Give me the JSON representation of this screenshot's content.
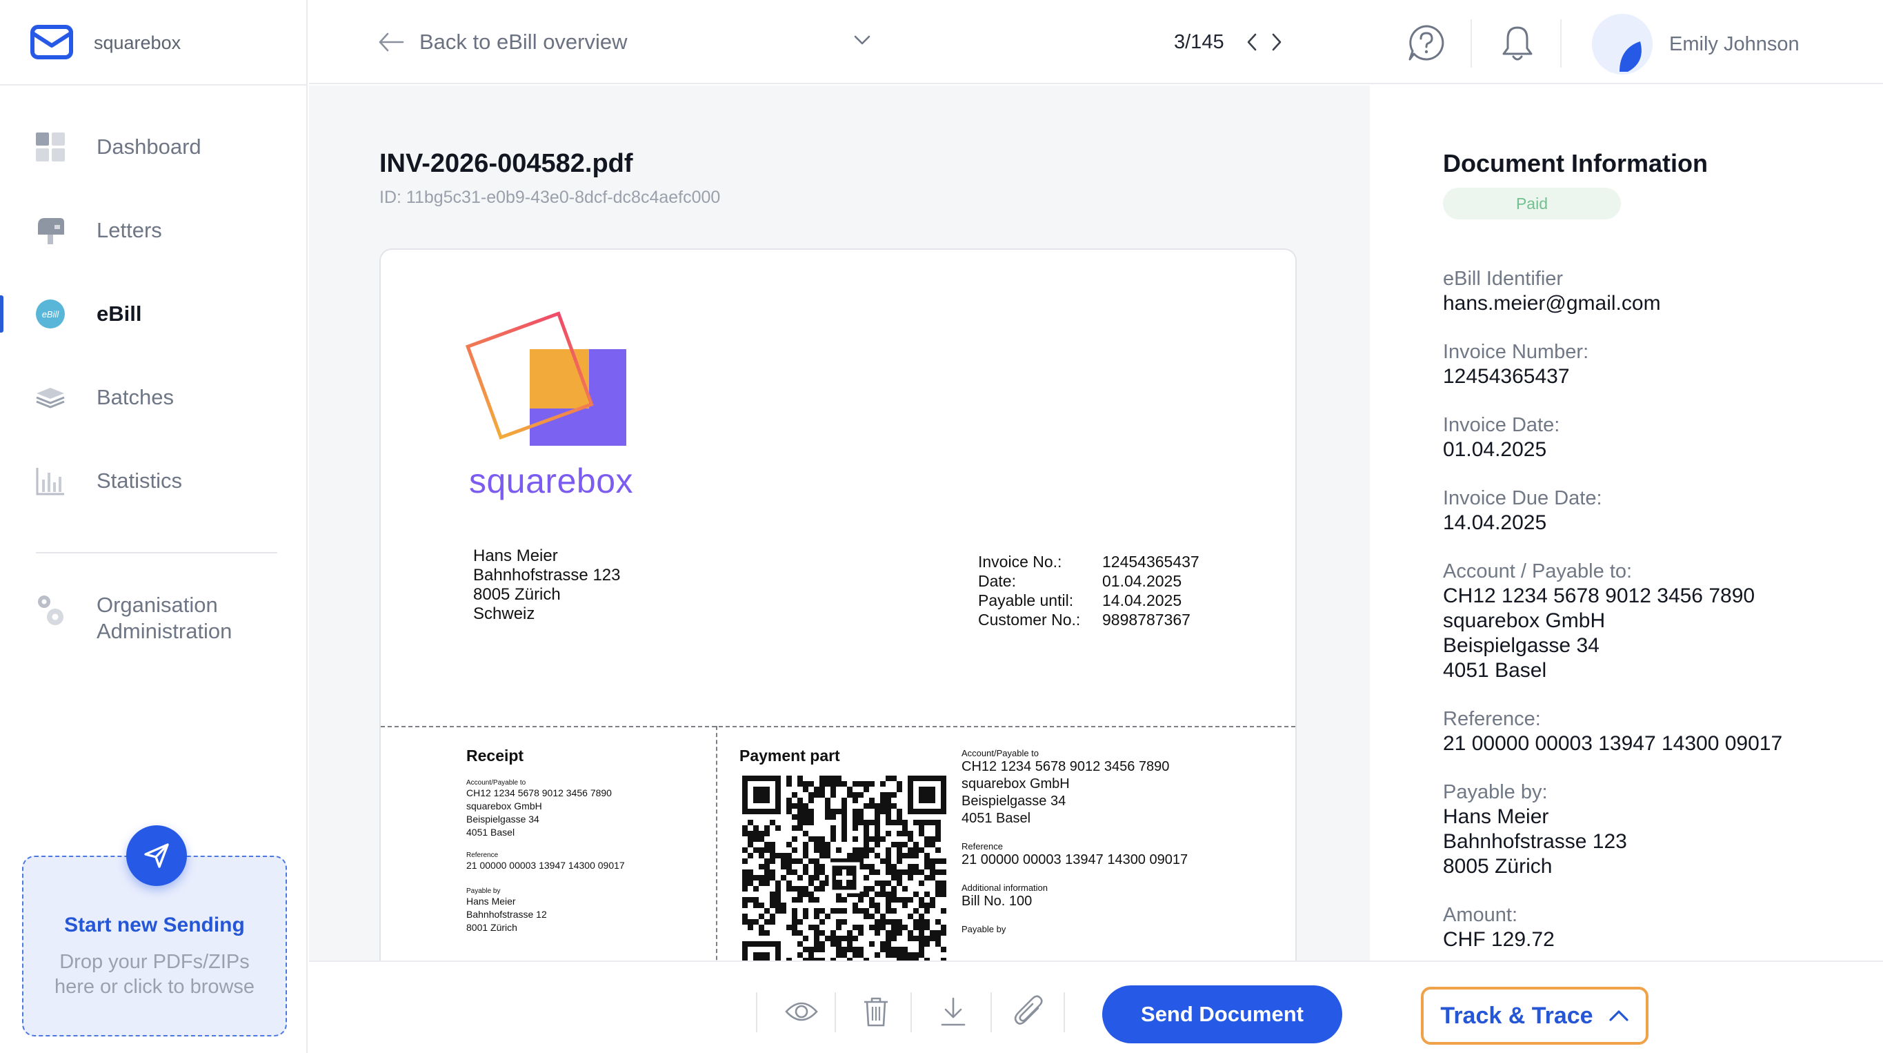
{
  "brand": {
    "name": "squarebox"
  },
  "sidebar": {
    "items": [
      {
        "label": "Dashboard",
        "icon": "dashboard-icon"
      },
      {
        "label": "Letters",
        "icon": "mailbox-icon"
      },
      {
        "label": "eBill",
        "icon": "ebill-icon",
        "badge": "eBill",
        "active": true
      },
      {
        "label": "Batches",
        "icon": "layers-icon"
      },
      {
        "label": "Statistics",
        "icon": "bar-chart-icon"
      }
    ],
    "org": {
      "label": "Organisation Administration",
      "icon": "gears-icon"
    },
    "upload": {
      "title": "Start new Sending",
      "subtitle": "Drop your PDFs/ZIPs here or click to browse",
      "icon": "send-icon"
    }
  },
  "header": {
    "back_label": "Back to eBill overview",
    "pager": "3/145",
    "user": {
      "name": "Emily Johnson"
    }
  },
  "document": {
    "filename": "INV-2026-004582.pdf",
    "id": "ID: 11bg5c31-e0b9-43e0-8dcf-dc8c4aefc000",
    "preview": {
      "logo_text_a": "square",
      "logo_text_b": "box",
      "recipient": [
        "Hans Meier",
        "Bahnhofstrasse 123",
        "8005 Zürich",
        "Schweiz"
      ],
      "meta": [
        {
          "k": "Invoice No.:",
          "v": "12454365437"
        },
        {
          "k": "Date:",
          "v": "01.04.2025"
        },
        {
          "k": "Payable until:",
          "v": "14.04.2025"
        },
        {
          "k": "Customer No.:",
          "v": "9898787367"
        }
      ],
      "receipt": {
        "title": "Receipt",
        "account_label": "Account/Payable to",
        "account": [
          "CH12 1234 5678 9012 3456 7890",
          "squarebox GmbH",
          "Beispielgasse 34",
          "4051 Basel"
        ],
        "reference_label": "Reference",
        "reference": "21 00000 00003 13947 14300 09017",
        "payable_by_label": "Payable by",
        "payable_by": [
          "Hans Meier",
          "Bahnhofstrasse 12",
          "8001 Zürich"
        ]
      },
      "payment": {
        "title": "Payment part",
        "account_label": "Account/Payable to",
        "account": [
          "CH12 1234 5678 9012 3456 7890",
          "squarebox GmbH",
          "Beispielgasse 34",
          "4051 Basel"
        ],
        "reference_label": "Reference",
        "reference": "21 00000 00003 13947 14300 09017",
        "additional_label": "Additional information",
        "additional": "Bill No. 100",
        "payable_by_label": "Payable by"
      }
    }
  },
  "info": {
    "title": "Document Information",
    "status": "Paid",
    "fields": [
      {
        "label": "eBill Identifier",
        "value": [
          "hans.meier@gmail.com"
        ]
      },
      {
        "label": "Invoice Number:",
        "value": [
          "12454365437"
        ]
      },
      {
        "label": "Invoice Date:",
        "value": [
          "01.04.2025"
        ]
      },
      {
        "label": "Invoice Due Date:",
        "value": [
          "14.04.2025"
        ]
      },
      {
        "label": "Account / Payable to:",
        "value": [
          "CH12 1234 5678 9012 3456 7890",
          "squarebox GmbH",
          "Beispielgasse 34",
          "4051 Basel"
        ]
      },
      {
        "label": "Reference:",
        "value": [
          "21 00000 00003 13947 14300 09017"
        ]
      },
      {
        "label": "Payable by:",
        "value": [
          "Hans Meier",
          "Bahnhofstrasse 123",
          "8005 Zürich"
        ]
      },
      {
        "label": "Amount:",
        "value": [
          "CHF 129.72"
        ]
      }
    ]
  },
  "toolbar": {
    "send_label": "Send Document",
    "track_label": "Track & Trace"
  },
  "colors": {
    "accent": "#2659e6",
    "highlight": "#f0a24a",
    "paid": "#72bf8f"
  }
}
